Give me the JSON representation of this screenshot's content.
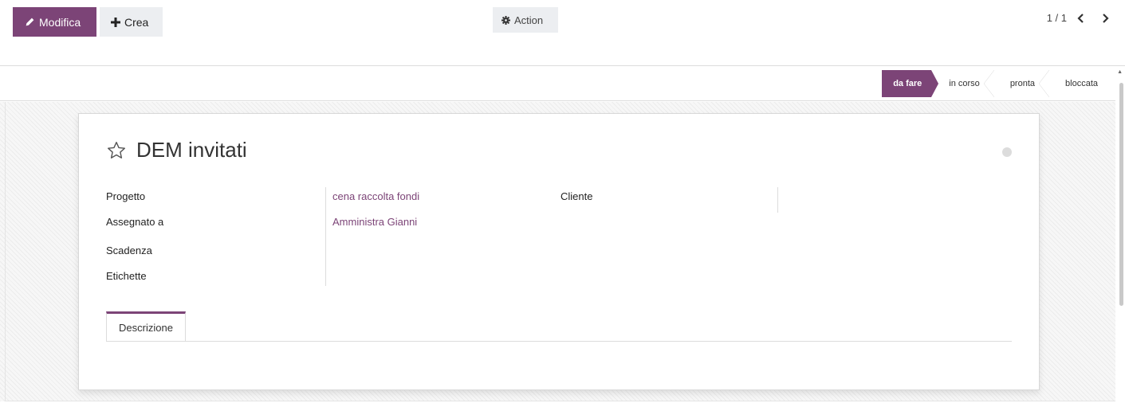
{
  "toolbar": {
    "edit_label": "Modifica",
    "create_label": "Crea",
    "action_label": "Action"
  },
  "pager": {
    "value": "1 / 1"
  },
  "stages": [
    "da fare",
    "in corso",
    "pronta",
    "bloccata"
  ],
  "active_stage": "da fare",
  "task": {
    "title": "DEM invitati",
    "fields": {
      "progetto_label": "Progetto",
      "progetto_value": "cena raccolta fondi",
      "assegnato_label": "Assegnato a",
      "assegnato_value": "Amministra Gianni",
      "scadenza_label": "Scadenza",
      "etichette_label": "Etichette",
      "cliente_label": "Cliente"
    },
    "tab_label": "Descrizione"
  },
  "colors": {
    "accent": "#7c4477",
    "button_grey": "#eceef1"
  },
  "icons": [
    "pencil-icon",
    "plus-icon",
    "gear-icon",
    "chevron-left-icon",
    "chevron-right-icon",
    "star-outline-icon",
    "status-dot-icon"
  ]
}
